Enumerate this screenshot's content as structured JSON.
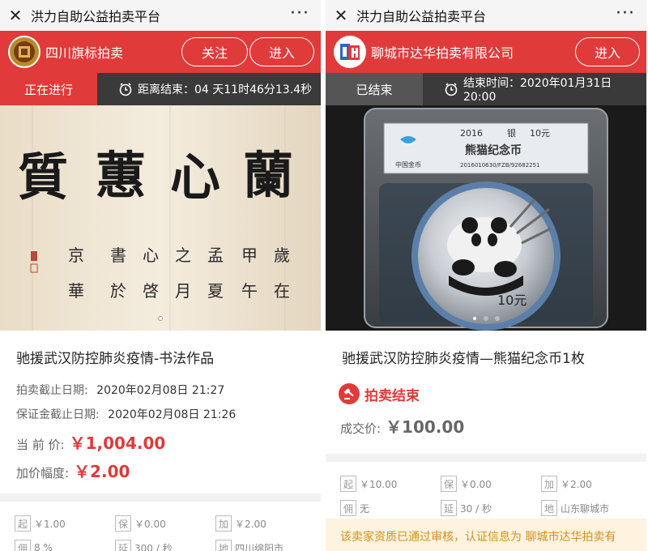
{
  "colors": {
    "brand_red": "#e03a3a",
    "dark_bar": "#3a3a3a",
    "ended_gray": "#555555",
    "notice_bg": "#fdf3de",
    "notice_text": "#d4901e"
  },
  "left": {
    "topbar": {
      "close_icon": "close-icon",
      "title": "洪力自助公益拍卖平台",
      "more_icon": "more-dots-icon",
      "more": "···"
    },
    "seller": {
      "name": "四川旗标拍卖",
      "follow": "关注",
      "enter": "进入"
    },
    "status": {
      "state": "正在进行",
      "countdown": "距离结束：04 天11时46分13.4秒"
    },
    "hero": {
      "calligraphy_row1": [
        "質",
        "蕙",
        "心",
        "蘭"
      ],
      "inscription_col_pairs": [
        [
          "京",
          "華"
        ],
        [
          "書",
          "於"
        ],
        [
          "心",
          "啓"
        ],
        [
          "之",
          "月"
        ],
        [
          "孟",
          "夏"
        ],
        [
          "甲",
          "午"
        ],
        [
          "歲",
          "在"
        ]
      ],
      "slides": 1,
      "active_slide": 0
    },
    "product": {
      "title": "驰援武汉防控肺炎疫情-书法作品",
      "deadline_label": "拍卖截止日期:",
      "deadline": "2020年02月08日 21:27",
      "deposit_label": "保证金截止日期:",
      "deposit": "2020年02月08日 21:26",
      "current_label": "当 前 价:",
      "current": "￥1,004.00",
      "increment_label": "加价幅度:",
      "increment": "￥2.00"
    },
    "grid": [
      {
        "tag": "起",
        "value": "￥1.00"
      },
      {
        "tag": "保",
        "value": "￥0.00"
      },
      {
        "tag": "加",
        "value": "￥2.00"
      },
      {
        "tag": "佣",
        "value": "8 %"
      },
      {
        "tag": "延",
        "value": "300 / 秒"
      },
      {
        "tag": "地",
        "value": "四川绵阳市"
      }
    ]
  },
  "right": {
    "topbar": {
      "close_icon": "close-icon",
      "title": "洪力自助公益拍卖平台",
      "more_icon": "more-dots-icon",
      "more": "···"
    },
    "seller": {
      "name": "聊城市达华拍卖有限公司",
      "enter": "进入"
    },
    "status": {
      "state": "已结束",
      "end_time": "结束时间：2020年01月31日 20:00"
    },
    "hero": {
      "label_year": "2016",
      "label_metal": "银",
      "label_value": "10元",
      "label_name": "熊猫纪念币",
      "label_serial": "2016010630/FZB/92682251",
      "label_issuer": "中国金币",
      "coin_face": "10元",
      "slides": 3,
      "active_slide": 0
    },
    "product": {
      "title": "驰援武汉防控肺炎疫情—熊猫纪念币1枚",
      "ended_text": "拍卖结束",
      "deal_label": "成交价:",
      "deal": "￥100.00"
    },
    "grid": [
      {
        "tag": "起",
        "value": "￥10.00"
      },
      {
        "tag": "保",
        "value": "￥0.00"
      },
      {
        "tag": "加",
        "value": "￥2.00"
      },
      {
        "tag": "佣",
        "value": "无"
      },
      {
        "tag": "延",
        "value": "30 / 秒"
      },
      {
        "tag": "地",
        "value": "山东聊城市"
      }
    ],
    "notice": "该卖家资质已通过审核，认证信息为 聊城市达华拍卖有"
  }
}
